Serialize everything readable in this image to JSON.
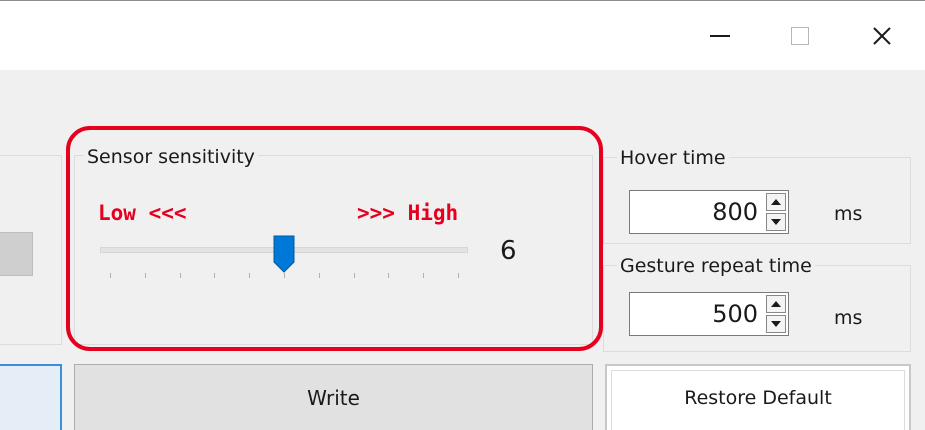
{
  "window": {
    "controls": {
      "minimize_icon": "minimize-icon",
      "maximize_icon": "maximize-icon",
      "close_icon": "close-icon"
    }
  },
  "sensor_sensitivity": {
    "caption": "Sensor sensitivity",
    "low_label": "Low <<<",
    "high_label": ">>> High",
    "value": "6",
    "min": 1,
    "max": 11,
    "current": 6,
    "highlight_color": "#e4001e",
    "thumb_color": "#0078d7"
  },
  "hover_time": {
    "caption": "Hover time",
    "value": "800",
    "unit": "ms"
  },
  "gesture_repeat_time": {
    "caption": "Gesture repeat time",
    "value": "500",
    "unit": "ms"
  },
  "buttons": {
    "write_label": "Write",
    "restore_label": "Restore Default"
  }
}
